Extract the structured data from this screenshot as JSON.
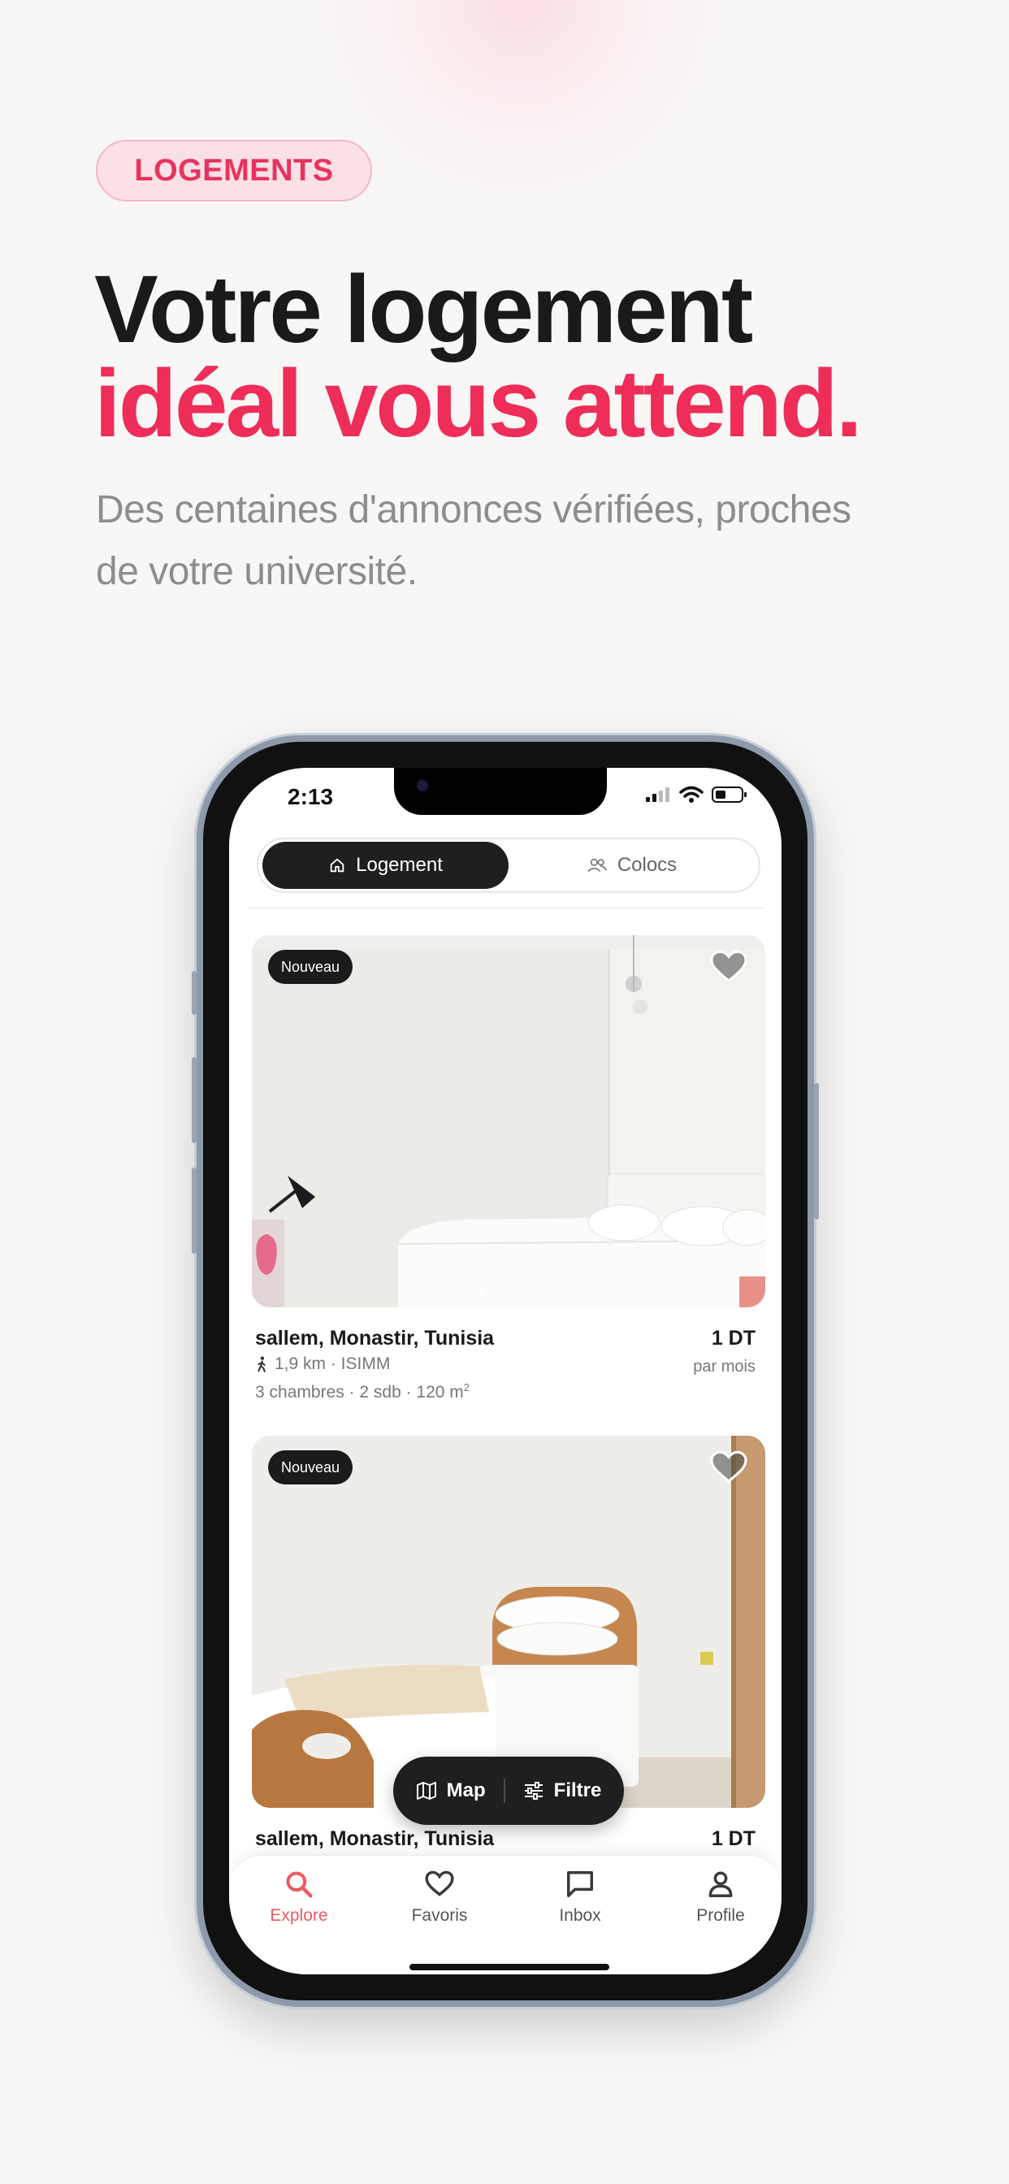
{
  "hero": {
    "tag": "LOGEMENTS",
    "title_line1": "Votre logement",
    "title_line2": "idéal vous attend.",
    "subtitle": "Des centaines d'annonces vérifiées, proches de votre université.",
    "accent_color": "#ee2d59"
  },
  "status_bar": {
    "time": "2:13"
  },
  "segmented": {
    "items": [
      {
        "label": "Logement",
        "icon": "home-icon",
        "active": true
      },
      {
        "label": "Colocs",
        "icon": "users-icon",
        "active": false
      }
    ]
  },
  "listings": [
    {
      "badge": "Nouveau",
      "title": "sallem, Monastir, Tunisia",
      "price": "1 DT",
      "period": "par mois",
      "distance": "1,9 km · ISIMM",
      "details": "3 chambres  ·  2 sdb  ·  120 m",
      "area_unit": "2",
      "photo_index": 1,
      "photo_count": 5
    },
    {
      "badge": "Nouveau",
      "title": "sallem, Monastir, Tunisia",
      "price": "1 DT"
    }
  ],
  "floating_bar": {
    "map_label": "Map",
    "filter_label": "Filtre"
  },
  "tabbar": {
    "items": [
      {
        "label": "Explore",
        "icon": "search-icon",
        "active": true
      },
      {
        "label": "Favoris",
        "icon": "heart-icon",
        "active": false
      },
      {
        "label": "Inbox",
        "icon": "message-icon",
        "active": false
      },
      {
        "label": "Profile",
        "icon": "person-icon",
        "active": false
      }
    ],
    "active_color": "#ec5b63"
  }
}
